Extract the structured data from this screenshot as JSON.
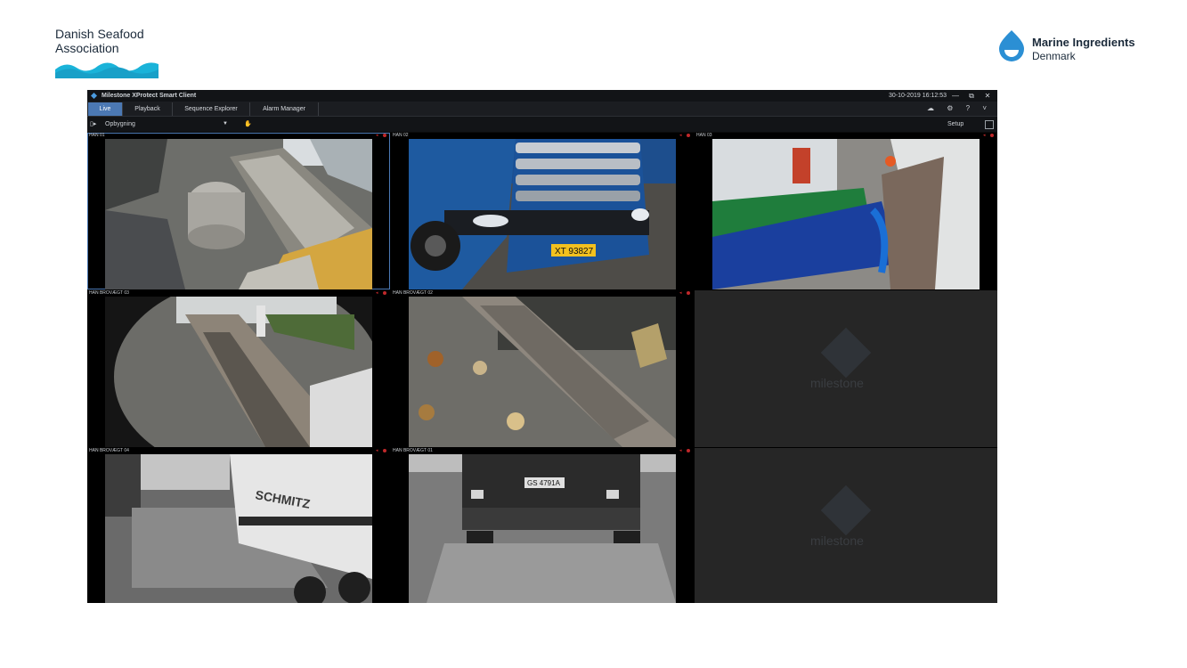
{
  "slide": {
    "left_logo": {
      "line1": "Danish Seafood",
      "line2": "Association"
    },
    "right_logo": {
      "line1": "Marine Ingredients",
      "line2": "Denmark"
    }
  },
  "app": {
    "title": "Milestone XProtect Smart Client",
    "datetime": "30-10-2019 16:12:53",
    "window_buttons": [
      "—",
      "⧉",
      "✕"
    ],
    "tabs": [
      {
        "label": "Live",
        "active": true
      },
      {
        "label": "Playback",
        "active": false
      },
      {
        "label": "Sequence Explorer",
        "active": false
      },
      {
        "label": "Alarm Manager",
        "active": false
      }
    ],
    "tab_icons": "☁ ⚙ ? ˅",
    "toolbar": {
      "view_name": "Opbygning",
      "dropdown": "▼",
      "setup_label": "Setup"
    },
    "cameras": [
      {
        "label": "HAN 01"
      },
      {
        "label": "HAN 02"
      },
      {
        "label": "HAN 03"
      },
      {
        "label": "HAN BROVÆGT 03"
      },
      {
        "label": "HAN BROVÆGT 02"
      },
      {
        "label": "HAN BROVÆGT 04"
      },
      {
        "label": "HAN BROVÆGT 01"
      }
    ],
    "plates": {
      "cam2": "XT 93827",
      "cam7": "GS 4791A"
    },
    "trailer_text": "SCHMITZ",
    "empty_watermark": "milestone",
    "colors": {
      "accent": "#4b78b3",
      "rec": "#c0282a",
      "brand_blue": "#1ab3d9"
    }
  }
}
